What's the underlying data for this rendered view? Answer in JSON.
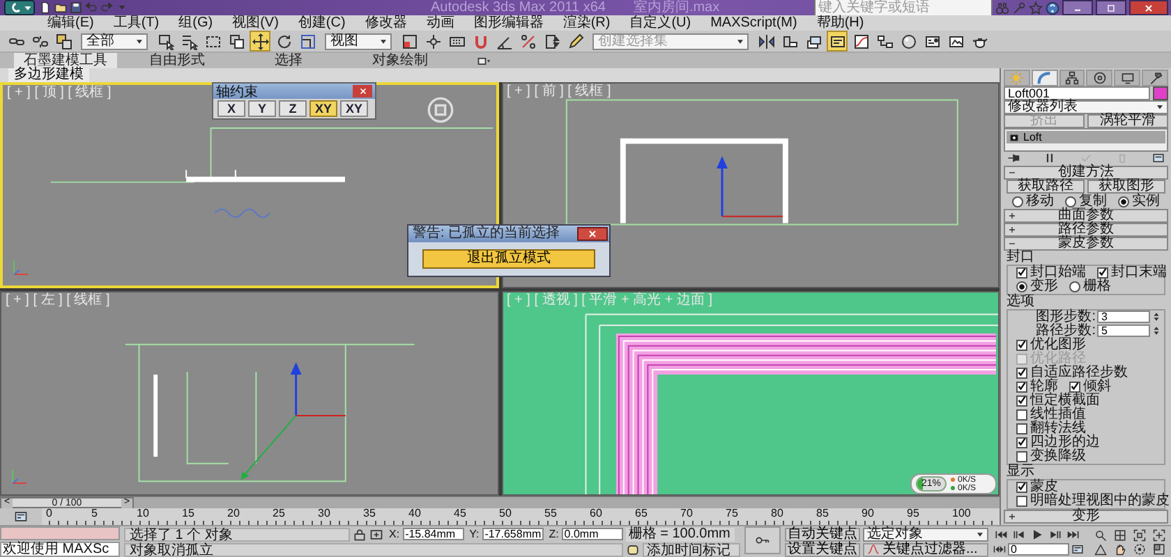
{
  "title_bar": {
    "title": "Autodesk 3ds Max 2011 x64",
    "file": "室内房间.max",
    "search": {
      "placeholder": "键入关键字或短语"
    }
  },
  "menu_bar": [
    "编辑(E)",
    "工具(T)",
    "组(G)",
    "视图(V)",
    "创建(C)",
    "修改器",
    "动画",
    "图形编辑器",
    "渲染(R)",
    "自定义(U)",
    "MAXScript(M)",
    "帮助(H)"
  ],
  "main_toolbar": [
    {
      "kind": "icon",
      "selected": false
    },
    {
      "kind": "icon",
      "selected": false
    },
    {
      "kind": "icon",
      "selected": false
    },
    {
      "kind": "dropdown",
      "value": "全部"
    },
    {
      "kind": "icon",
      "selected": false
    },
    {
      "kind": "icon",
      "selected": false
    },
    {
      "kind": "icon",
      "selected": false
    },
    {
      "kind": "icon",
      "selected": false
    },
    {
      "kind": "icon",
      "selected": true
    },
    {
      "kind": "icon",
      "selected": false
    },
    {
      "kind": "icon",
      "selected": false
    },
    {
      "kind": "dropdown",
      "value": "视图"
    },
    {
      "kind": "icon",
      "selected": false
    },
    {
      "kind": "icon",
      "selected": false
    },
    {
      "kind": "icon",
      "selected": false
    },
    {
      "kind": "icon",
      "selected": false
    },
    {
      "kind": "icon",
      "selected": false
    },
    {
      "kind": "icon",
      "selected": false
    },
    {
      "kind": "icon",
      "selected": false
    },
    {
      "kind": "icon",
      "selected": false
    },
    {
      "kind": "combo",
      "placeholder": "创建选择集"
    },
    {
      "kind": "icon",
      "selected": false
    },
    {
      "kind": "icon",
      "selected": false
    },
    {
      "kind": "icon",
      "selected": false
    },
    {
      "kind": "icon",
      "selected": true
    },
    {
      "kind": "icon",
      "selected": false
    },
    {
      "kind": "icon",
      "selected": false
    },
    {
      "kind": "icon",
      "selected": false
    },
    {
      "kind": "icon",
      "selected": false
    },
    {
      "kind": "icon",
      "selected": false
    },
    {
      "kind": "icon",
      "selected": false
    }
  ],
  "ribbon": {
    "tabs": [
      {
        "label": "石墨建模工具",
        "selected": true
      },
      {
        "label": "自由形式",
        "selected": false
      },
      {
        "label": "选择",
        "selected": false
      },
      {
        "label": "对象绘制",
        "selected": false
      }
    ],
    "panel": "多边形建模"
  },
  "viewports": {
    "items": [
      {
        "label": "[ + ] [ 顶 ] [ 线框 ]",
        "kind": "top",
        "active": true
      },
      {
        "label": "[ + ] [ 前 ] [ 线框 ]",
        "kind": "front",
        "active": false
      },
      {
        "label": "[ + ] [ 左 ] [ 线框 ]",
        "kind": "left",
        "active": false
      },
      {
        "label": "[ + ] [ 透视 ] [ 平滑 + 高光 + 边面 ]",
        "kind": "perspective",
        "active": false
      }
    ],
    "axis_constraints": {
      "title": "轴约束",
      "buttons": [
        {
          "label": "X",
          "selected": false
        },
        {
          "label": "Y",
          "selected": false
        },
        {
          "label": "Z",
          "selected": false
        },
        {
          "label": "XY",
          "selected": true
        },
        {
          "label": "XY",
          "selected": false
        }
      ]
    },
    "isolate_dialog": {
      "title": "警告: 已孤立的当前选择",
      "button": "退出孤立模式"
    },
    "memory_gauge": {
      "reading": "21%",
      "level": 0.21,
      "rates": [
        {
          "text": "0K/S",
          "color": "#e07a30"
        },
        {
          "text": "0K/S",
          "color": "#3aa040"
        }
      ]
    }
  },
  "time_slider": {
    "prev": "<",
    "label": "0 / 100",
    "next": ">",
    "level": 0
  },
  "ruler": [
    "0",
    "5",
    "10",
    "15",
    "20",
    "25",
    "30",
    "35",
    "40",
    "45",
    "50",
    "55",
    "60",
    "65",
    "70",
    "75",
    "80",
    "85",
    "90",
    "95",
    "100"
  ],
  "command_panel": {
    "tabs": [
      {
        "selected": false
      },
      {
        "selected": true
      },
      {
        "selected": false
      },
      {
        "selected": false
      },
      {
        "selected": false
      },
      {
        "selected": false
      }
    ],
    "object": {
      "name": "Loft001",
      "color": "#e040c8"
    },
    "modifier_list": "修改器列表",
    "modifier_buttons": [
      {
        "label": "挤出",
        "disabled": true
      },
      {
        "label": "涡轮平滑",
        "disabled": false
      }
    ],
    "stack": [
      {
        "label": "Loft",
        "selected": true
      }
    ],
    "rollouts": [
      {
        "title": "创建方法",
        "expanded": true,
        "rows": [
          {
            "kind": "buttons",
            "items": [
              "获取路径",
              "获取图形"
            ]
          },
          {
            "kind": "radios",
            "items": [
              {
                "label": "移动",
                "selected": false
              },
              {
                "label": "复制",
                "selected": false
              },
              {
                "label": "实例",
                "selected": true
              }
            ]
          }
        ]
      },
      {
        "title": "曲面参数",
        "expanded": false
      },
      {
        "title": "路径参数",
        "expanded": false
      },
      {
        "title": "蒙皮参数",
        "expanded": true,
        "groups": [
          {
            "title": "封口",
            "rows": [
              {
                "kind": "checks",
                "items": [
                  {
                    "label": "封口始端",
                    "checked": true,
                    "disabled": false
                  },
                  {
                    "label": "封口末端",
                    "checked": true,
                    "disabled": false
                  }
                ]
              },
              {
                "kind": "radios",
                "items": [
                  {
                    "label": "变形",
                    "selected": true
                  },
                  {
                    "label": "栅格",
                    "selected": false
                  }
                ]
              }
            ]
          },
          {
            "title": "选项",
            "rows": [
              {
                "kind": "spinner",
                "label": "图形步数:",
                "value": "3"
              },
              {
                "kind": "spinner",
                "label": "路径步数:",
                "value": "5"
              },
              {
                "kind": "checks",
                "items": [
                  {
                    "label": "优化图形",
                    "checked": true,
                    "disabled": false
                  }
                ]
              },
              {
                "kind": "checks",
                "items": [
                  {
                    "label": "优化路径",
                    "checked": false,
                    "disabled": true
                  }
                ]
              },
              {
                "kind": "checks",
                "items": [
                  {
                    "label": "自适应路径步数",
                    "checked": true,
                    "disabled": false
                  }
                ]
              },
              {
                "kind": "checks",
                "items": [
                  {
                    "label": "轮廓",
                    "checked": true,
                    "disabled": false
                  },
                  {
                    "label": "倾斜",
                    "checked": true,
                    "disabled": false
                  }
                ]
              },
              {
                "kind": "checks",
                "items": [
                  {
                    "label": "恒定横截面",
                    "checked": true,
                    "disabled": false
                  }
                ]
              },
              {
                "kind": "checks",
                "items": [
                  {
                    "label": "线性插值",
                    "checked": false,
                    "disabled": false
                  }
                ]
              },
              {
                "kind": "checks",
                "items": [
                  {
                    "label": "翻转法线",
                    "checked": false,
                    "disabled": false
                  }
                ]
              },
              {
                "kind": "checks",
                "items": [
                  {
                    "label": "四边形的边",
                    "checked": true,
                    "disabled": false
                  }
                ]
              },
              {
                "kind": "checks",
                "items": [
                  {
                    "label": "变换降级",
                    "checked": false,
                    "disabled": false
                  }
                ]
              }
            ]
          },
          {
            "title": "显示",
            "rows": [
              {
                "kind": "checks",
                "items": [
                  {
                    "label": "蒙皮",
                    "checked": true,
                    "disabled": false
                  }
                ]
              },
              {
                "kind": "checks",
                "items": [
                  {
                    "label": "明暗处理视图中的蒙皮",
                    "checked": false,
                    "disabled": false
                  }
                ]
              }
            ]
          }
        ]
      },
      {
        "title": "变形",
        "expanded": false
      }
    ]
  },
  "status_bar": {
    "listener_output": "欢迎使用 MAXSc",
    "prompt": "选择了 1 个 对象",
    "hint": "对象取消孤立",
    "coordinates": [
      {
        "label": "X:",
        "value": "-15.84mm"
      },
      {
        "label": "Y:",
        "value": "-17.658mm"
      },
      {
        "label": "Z:",
        "value": "0.0mm"
      }
    ],
    "grid": "栅格 = 100.0mm",
    "time_tag": "添加时间标记",
    "auto_key": {
      "label": "自动关键点",
      "on": false
    },
    "set_key": "设置关键点",
    "key_target": "选定对象",
    "key_filters": "关键点过滤器...",
    "frame": "0"
  }
}
